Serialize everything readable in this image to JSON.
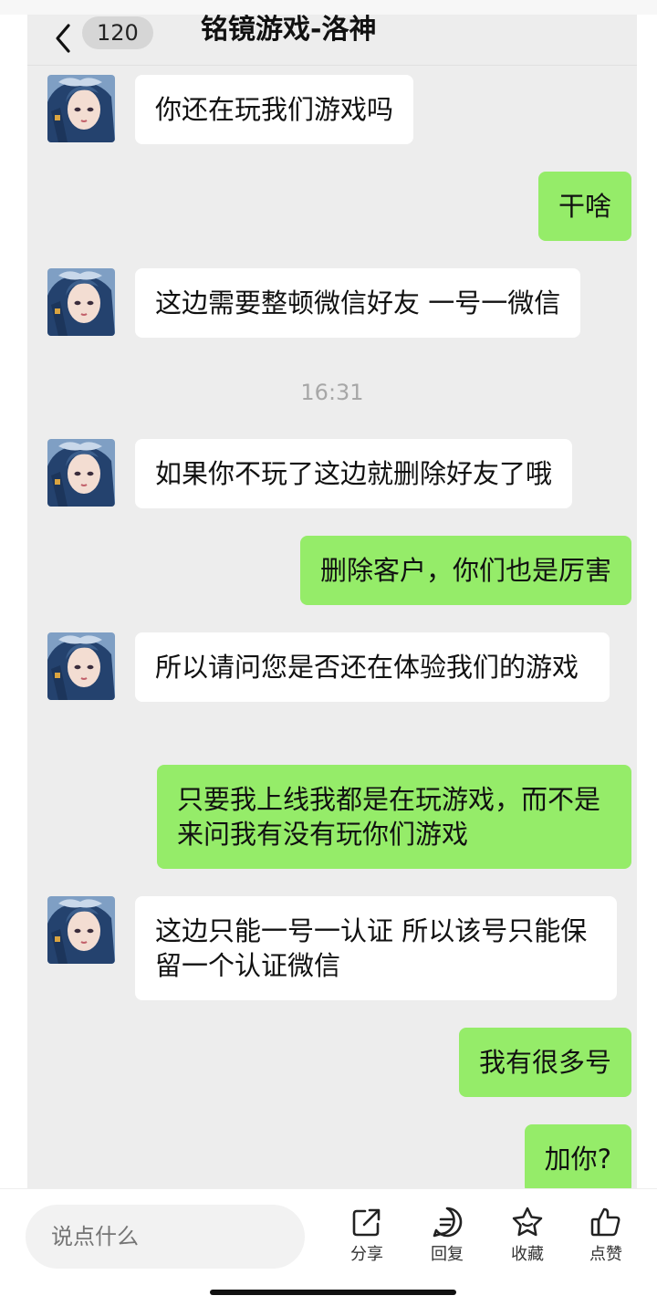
{
  "header": {
    "unread_count": "120",
    "title": "铭镜游戏-洛神"
  },
  "messages": [
    {
      "side": "in",
      "text": "你还在玩我们游戏吗"
    },
    {
      "side": "out",
      "text": "干啥"
    },
    {
      "side": "in",
      "text": "这边需要整顿微信好友 一号一微信"
    },
    {
      "side": "in",
      "text": "如果你不玩了这边就删除好友了哦"
    },
    {
      "side": "out",
      "text": "删除客户，你们也是厉害"
    },
    {
      "side": "in",
      "text": "所以请问您是否还在体验我们的游戏"
    },
    {
      "side": "out",
      "text": "只要我上线我都是在玩游戏，而不是来问我有没有玩你们游戏"
    },
    {
      "side": "in",
      "text": "这边只能一号一认证 所以该号只能保留一个认证微信"
    },
    {
      "side": "out",
      "text": "我有很多号"
    },
    {
      "side": "out",
      "text": "加你?"
    }
  ],
  "timestamp": "16:31",
  "colors": {
    "chat_background": "#ededed",
    "outgoing_bubble": "#95ec69",
    "incoming_bubble": "#ffffff"
  },
  "bottom_bar": {
    "input_placeholder": "说点什么",
    "share_label": "分享",
    "reply_label": "回复",
    "favorite_label": "收藏",
    "like_label": "点赞",
    "icons": [
      "share-icon",
      "reply-icon",
      "star-icon",
      "thumbs-up-icon"
    ]
  }
}
